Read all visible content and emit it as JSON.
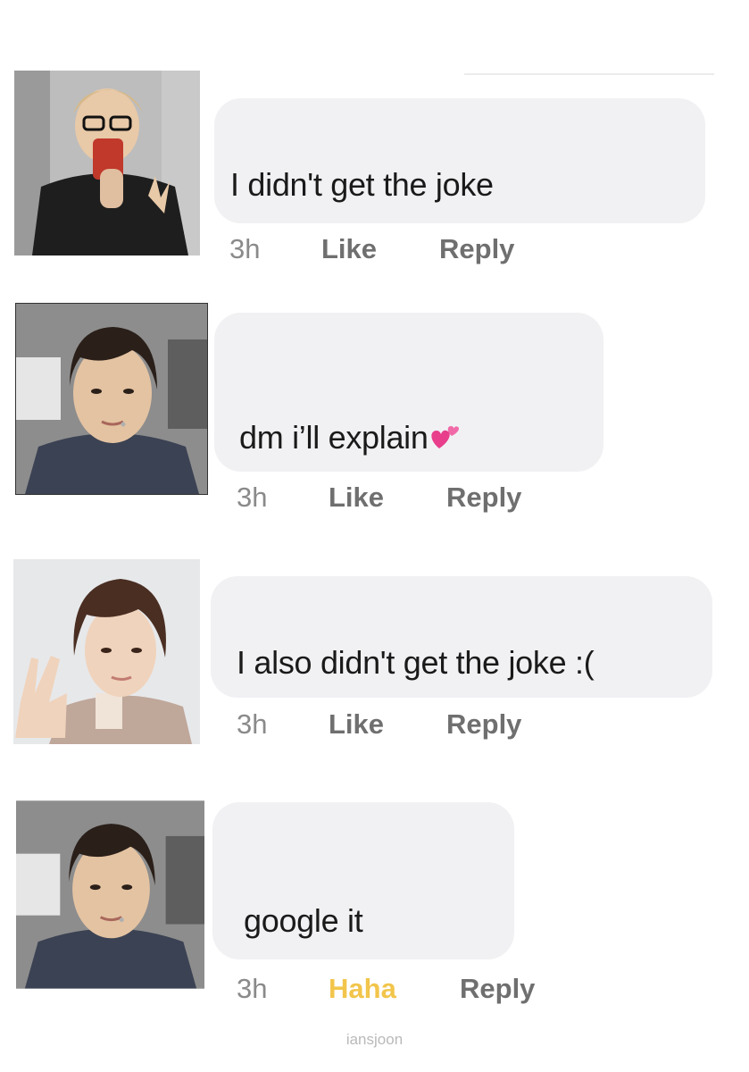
{
  "comments": [
    {
      "avatar_icon": "user-avatar-rm",
      "text": "I didn't get the joke",
      "time": "3h",
      "reaction_label": "Like",
      "reply_label": "Reply"
    },
    {
      "avatar_icon": "user-avatar-jk",
      "text": "dm i’ll explain",
      "emoji": "two-hearts-emoji",
      "time": "3h",
      "reaction_label": "Like",
      "reply_label": "Reply"
    },
    {
      "avatar_icon": "user-avatar-jin",
      "text": "I also didn't get the joke :(",
      "time": "3h",
      "reaction_label": "Like",
      "reply_label": "Reply"
    },
    {
      "avatar_icon": "user-avatar-jk",
      "text": "google it",
      "time": "3h",
      "reaction_label": "Haha",
      "reply_label": "Reply"
    }
  ],
  "watermark": "iansjoon",
  "colors": {
    "bubble": "#f1f1f4",
    "time": "#8a8a8a",
    "action": "#6f6f6f",
    "haha": "#f2c54b"
  }
}
